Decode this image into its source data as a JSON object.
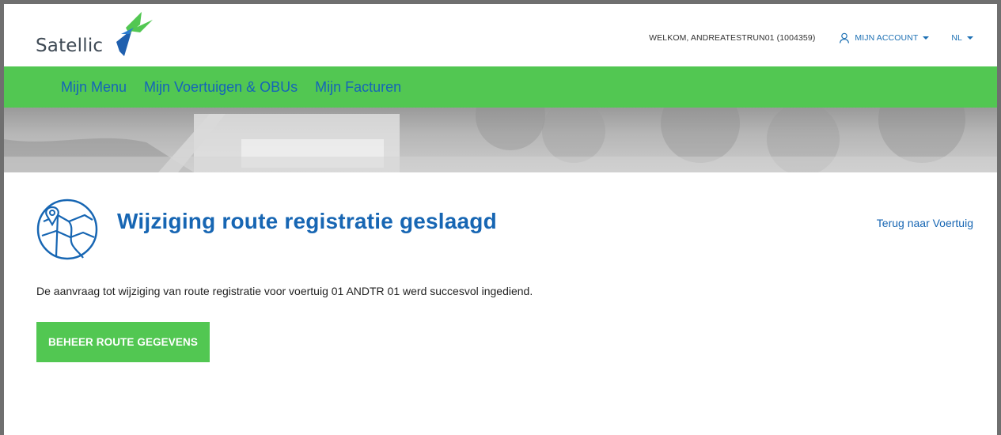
{
  "brand": {
    "name": "Satellic"
  },
  "header": {
    "welcome": "WELKOM, ANDREATESTRUN01 (1004359)",
    "account_label": "MIJN ACCOUNT",
    "language": "NL"
  },
  "nav": {
    "items": [
      {
        "label": "Mijn Menu"
      },
      {
        "label": "Mijn Voertuigen & OBUs"
      },
      {
        "label": "Mijn Facturen"
      }
    ]
  },
  "page": {
    "title": "Wijziging route registratie geslaagd",
    "back_link": "Terug naar Voertuig",
    "message": "De aanvraag tot wijziging van route registratie voor voertuig 01 ANDTR 01 werd succesvol ingediend.",
    "primary_button": "BEHEER ROUTE GEGEVENS"
  },
  "icons": {
    "logo_mark": "satellic-logo-icon",
    "account": "user-icon",
    "page": "map-route-icon"
  },
  "colors": {
    "green": "#52c752",
    "blue": "#1766b3",
    "frame": "#6f6f6f"
  }
}
